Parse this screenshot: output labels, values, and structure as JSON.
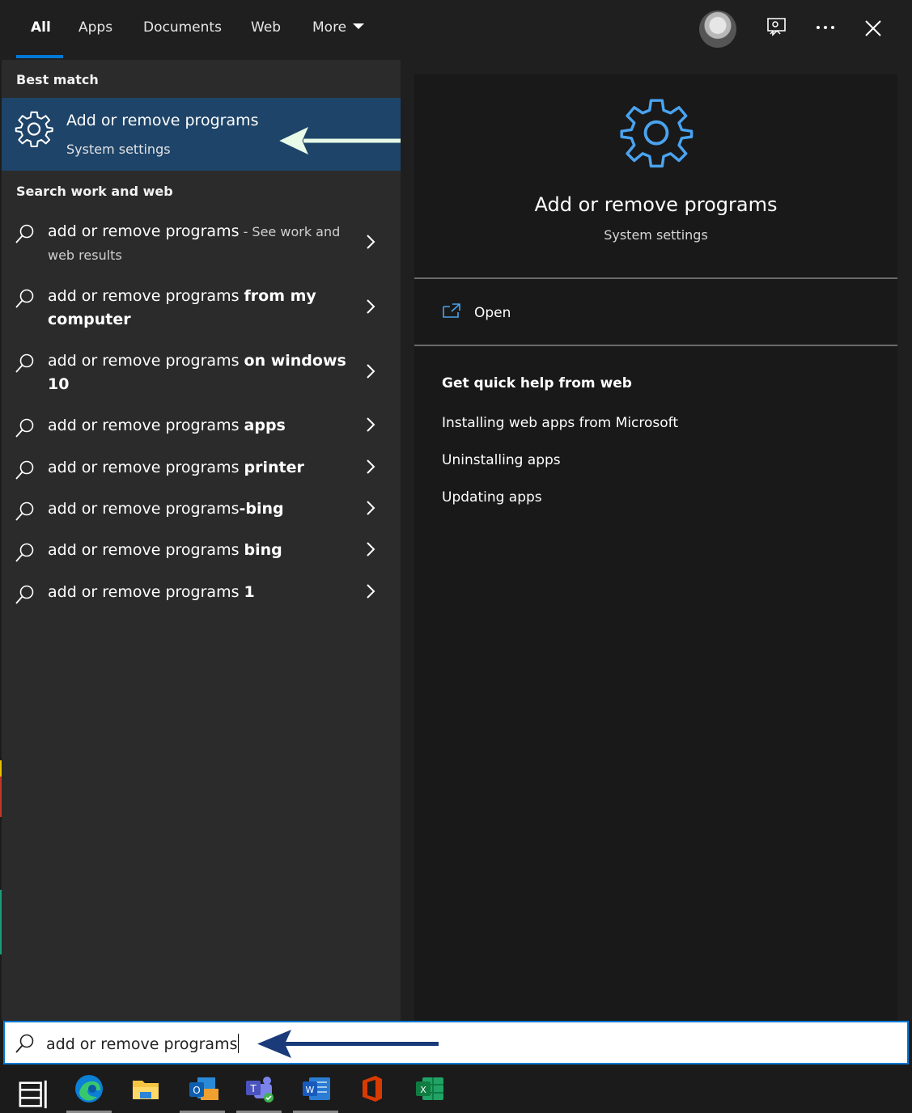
{
  "tabs": [
    {
      "label": "All",
      "active": true
    },
    {
      "label": "Apps"
    },
    {
      "label": "Documents"
    },
    {
      "label": "Web"
    },
    {
      "label": "More"
    }
  ],
  "left": {
    "best_match_heading": "Best match",
    "best_match": {
      "title": "Add or remove programs",
      "subtitle": "System settings",
      "icon": "gear-icon"
    },
    "search_web_heading": "Search work and web",
    "results": [
      {
        "query": "add or remove programs",
        "suffix": "",
        "hint": " - See work and web results"
      },
      {
        "query": "add or remove programs ",
        "suffix": "from my computer",
        "hint": ""
      },
      {
        "query": "add or remove programs ",
        "suffix": "on windows 10",
        "hint": ""
      },
      {
        "query": "add or remove programs ",
        "suffix": "apps",
        "hint": ""
      },
      {
        "query": "add or remove programs ",
        "suffix": "printer",
        "hint": ""
      },
      {
        "query": "add or remove programs",
        "suffix": "-bing",
        "hint": ""
      },
      {
        "query": "add or remove programs ",
        "suffix": "bing",
        "hint": ""
      },
      {
        "query": "add or remove programs ",
        "suffix": "1",
        "hint": ""
      }
    ]
  },
  "right": {
    "title": "Add or remove programs",
    "subtitle": "System settings",
    "open_label": "Open",
    "help_heading": "Get quick help from web",
    "help_links": [
      "Installing web apps from Microsoft",
      "Uninstalling apps",
      "Updating apps"
    ]
  },
  "search": {
    "value": "add or remove programs"
  },
  "colors": {
    "accent": "#0078d4",
    "gear": "#4aa3f0",
    "arrow_light": "#e8fbe8",
    "arrow_dark": "#1a3a7a"
  },
  "taskbar": [
    "task-view-icon",
    "edge-icon",
    "file-explorer-icon",
    "outlook-icon",
    "teams-icon",
    "word-icon",
    "office-icon",
    "excel-icon"
  ]
}
